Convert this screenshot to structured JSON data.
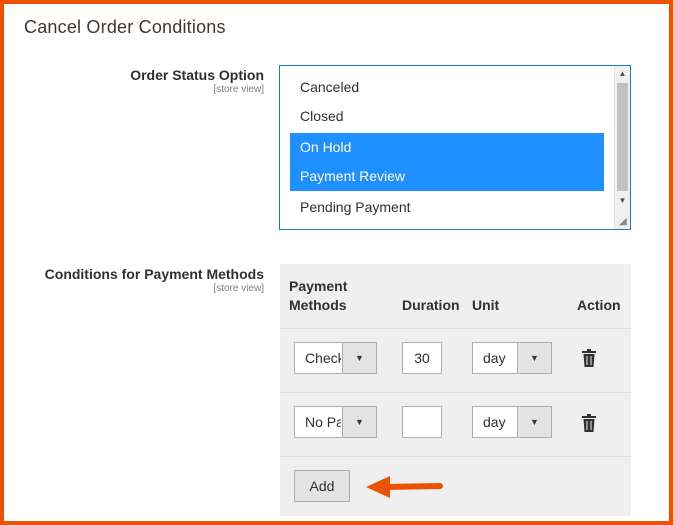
{
  "section": {
    "title": "Cancel Order Conditions"
  },
  "order_status": {
    "label": "Order Status Option",
    "scope": "[store view]",
    "options": [
      {
        "label": "Canceled",
        "selected": false
      },
      {
        "label": "Closed",
        "selected": false
      },
      {
        "label": "On Hold",
        "selected": true
      },
      {
        "label": "Payment Review",
        "selected": true
      },
      {
        "label": "Pending Payment",
        "selected": false
      }
    ]
  },
  "payment_conditions": {
    "label": "Conditions for Payment Methods",
    "scope": "[store view]",
    "headers": {
      "payment_methods_line1": "Payment",
      "payment_methods_line2": "Methods",
      "duration": "Duration",
      "unit": "Unit",
      "action": "Action"
    },
    "rows": [
      {
        "payment_method": "Check / Money order",
        "duration": "30",
        "unit": "day"
      },
      {
        "payment_method": "No Payment Information Required",
        "duration": "",
        "unit": "day"
      }
    ],
    "add_label": "Add"
  },
  "colors": {
    "frame": "#eb5202",
    "selection": "#1e90ff",
    "arrow": "#eb5202"
  }
}
